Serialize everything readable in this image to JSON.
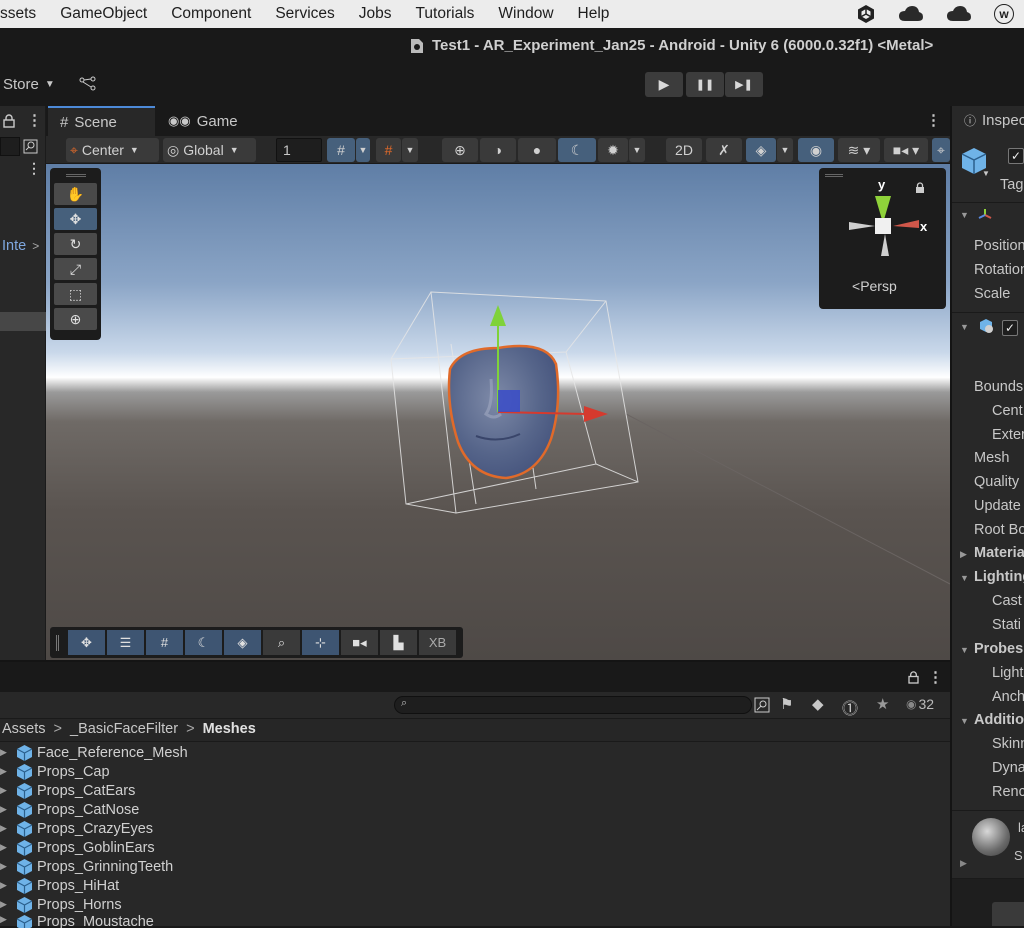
{
  "menubar": {
    "items": [
      "ssets",
      "GameObject",
      "Component",
      "Services",
      "Jobs",
      "Tutorials",
      "Window",
      "Help"
    ],
    "tray": [
      "unity-icon",
      "cloud-icon",
      "cloud-icon",
      "account-icon"
    ],
    "account_letter": "w"
  },
  "window": {
    "title": "Test1 - AR_Experiment_Jan25 - Android - Unity 6 (6000.0.32f1) <Metal>"
  },
  "toolbar": {
    "store_label": "Store",
    "play": "▶",
    "pause": "❚❚",
    "step": "▶❚"
  },
  "hierarchy": {
    "item_label": "Inte"
  },
  "scene_panel": {
    "tabs": [
      {
        "label": "Scene",
        "active": true
      },
      {
        "label": "Game",
        "active": false
      }
    ],
    "pivot_label": "Center",
    "space_label": "Global",
    "grid_size": "1",
    "gizmo": {
      "y_label": "y",
      "x_label": "x",
      "projection": "Persp"
    },
    "overlay_last": "XB"
  },
  "inspector": {
    "tab_label": "Inspec",
    "tag_label": "Tag",
    "rows": [
      {
        "label": "Position",
        "bold": false
      },
      {
        "label": "Rotation",
        "bold": false
      },
      {
        "label": "Scale",
        "bold": false
      },
      {
        "label": "Bounds",
        "bold": false
      },
      {
        "label": "Cent",
        "bold": false
      },
      {
        "label": "Exter",
        "bold": false
      },
      {
        "label": "Mesh",
        "bold": false
      },
      {
        "label": "Quality",
        "bold": false
      },
      {
        "label": "Update",
        "bold": false
      },
      {
        "label": "Root Bo",
        "bold": false
      },
      {
        "label": "Materia",
        "bold": true
      },
      {
        "label": "Lighting",
        "bold": true
      },
      {
        "label": "Cast",
        "bold": false
      },
      {
        "label": "Stati",
        "bold": false
      },
      {
        "label": "Probes",
        "bold": true
      },
      {
        "label": "Light",
        "bold": false
      },
      {
        "label": "Anch",
        "bold": false
      },
      {
        "label": "Additio",
        "bold": true
      },
      {
        "label": "Skinn",
        "bold": false
      },
      {
        "label": "Dyna",
        "bold": false
      },
      {
        "label": "Renc",
        "bold": false
      }
    ],
    "material_letters": [
      "la",
      "S"
    ]
  },
  "project": {
    "visible_count": "32",
    "breadcrumb": [
      "Assets",
      "_BasicFaceFilter",
      "Meshes"
    ],
    "assets": [
      "Face_Reference_Mesh",
      "Props_Cap",
      "Props_CatEars",
      "Props_CatNose",
      "Props_CrazyEyes",
      "Props_GoblinEars",
      "Props_GrinningTeeth",
      "Props_HiHat",
      "Props_Horns",
      "Props_Moustache"
    ]
  },
  "colors": {
    "selection_outline": "#e06a2a",
    "axis_x": "#d53a2e",
    "axis_y": "#7fd23a",
    "accent": "#46607c"
  }
}
